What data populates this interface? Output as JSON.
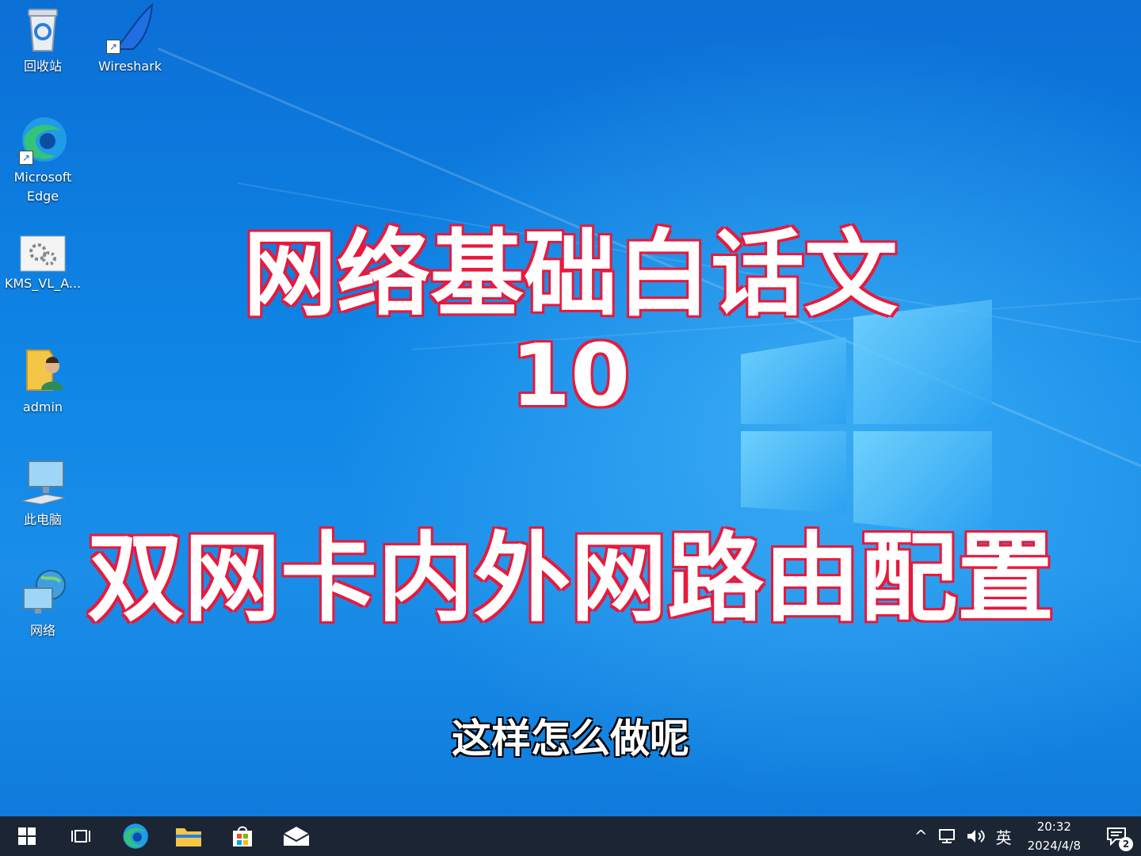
{
  "desktop_icons": [
    {
      "label": "回收站",
      "icon": "recycle-bin-icon"
    },
    {
      "label": "Wireshark",
      "icon": "wireshark-icon"
    },
    {
      "label": "Microsoft Edge",
      "icon": "edge-icon"
    },
    {
      "label": "KMS_VL_A...",
      "icon": "settings-file-icon"
    },
    {
      "label": "admin",
      "icon": "user-folder-icon"
    },
    {
      "label": "此电脑",
      "icon": "computer-icon"
    },
    {
      "label": "网络",
      "icon": "network-icon"
    }
  ],
  "overlay": {
    "title_line1": "网络基础白话文",
    "title_line2": "10",
    "title_line3": "双网卡内外网路由配置",
    "subtitle": "这样怎么做呢",
    "title_color": "#ffffff",
    "title_outline": "#e8193c"
  },
  "taskbar": {
    "pinned": [
      "start-icon",
      "task-view-icon",
      "edge-icon",
      "file-explorer-icon",
      "store-icon",
      "mail-icon"
    ],
    "tray": {
      "chevron": "^",
      "ime": "英",
      "time": "20:32",
      "date": "2024/4/8",
      "notifications": "2"
    }
  },
  "colors": {
    "taskbar_bg": "#1b2533",
    "desktop_blue": "#0f86e6"
  }
}
